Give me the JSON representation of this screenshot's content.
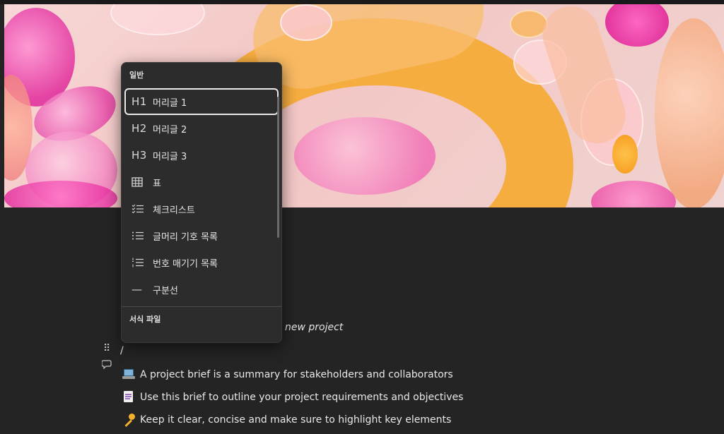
{
  "slash_menu": {
    "section_general": "일반",
    "items": [
      {
        "icon": "heading-1-icon",
        "glyph": "H1",
        "label": "머리글 1",
        "selected": true
      },
      {
        "icon": "heading-2-icon",
        "glyph": "H2",
        "label": "머리글 2",
        "selected": false
      },
      {
        "icon": "heading-3-icon",
        "glyph": "H3",
        "label": "머리글 3",
        "selected": false
      },
      {
        "icon": "table-icon",
        "glyph": "",
        "label": "표",
        "selected": false
      },
      {
        "icon": "checklist-icon",
        "glyph": "",
        "label": "체크리스트",
        "selected": false
      },
      {
        "icon": "bulleted-list-icon",
        "glyph": "",
        "label": "글머리 기호 목록",
        "selected": false
      },
      {
        "icon": "numbered-list-icon",
        "glyph": "",
        "label": "번호 매기기 목록",
        "selected": false
      },
      {
        "icon": "divider-icon",
        "glyph": "—",
        "label": "구분선",
        "selected": false
      }
    ],
    "section_templates": "서식 파일"
  },
  "document": {
    "partial_heading": "new project",
    "typed_text": "/",
    "bullets": [
      {
        "icon": "laptop-emoji-icon",
        "text": "A project brief is a summary for stakeholders and collaborators"
      },
      {
        "icon": "memo-emoji-icon",
        "text": "Use this brief to outline your project requirements and objectives"
      },
      {
        "icon": "key-emoji-icon",
        "text": "Keep it clear, concise and make sure to highlight key elements"
      }
    ]
  },
  "colors": {
    "background": "#242424",
    "menu_background": "#2c2c2c",
    "cover_accent_orange": "#f5a623",
    "cover_accent_pink": "#e8398f"
  }
}
